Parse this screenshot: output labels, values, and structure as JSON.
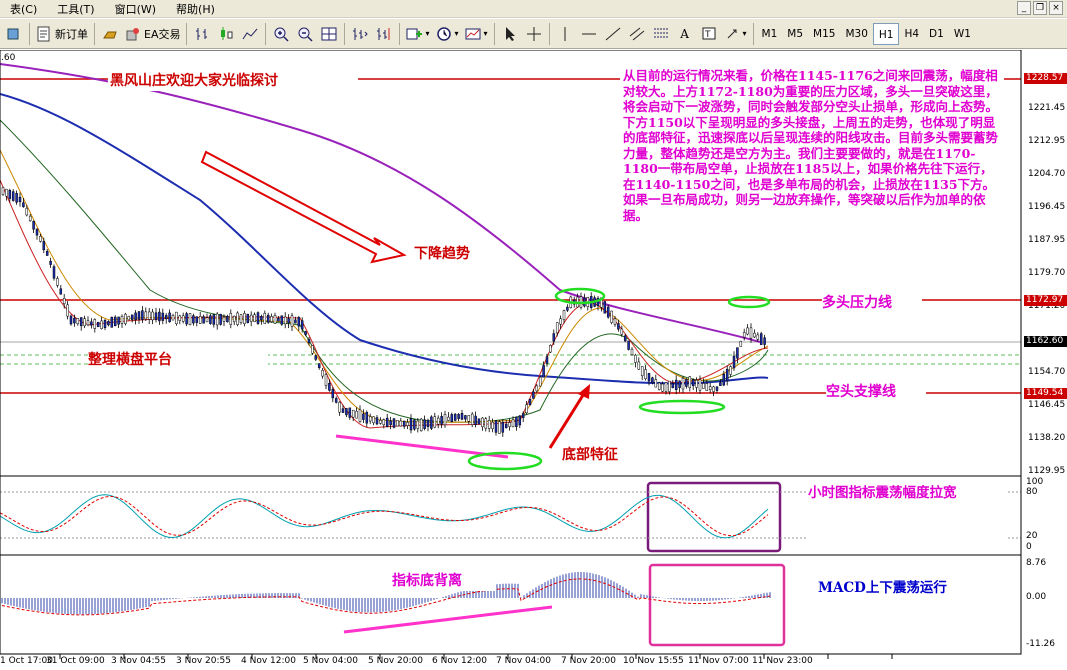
{
  "menu": {
    "items": [
      "表(C)",
      "工具(T)",
      "窗口(W)",
      "帮助(H)"
    ]
  },
  "toolbar": {
    "new_order_label": "新订单",
    "ea_label": "EA交易",
    "timeframes": [
      "M1",
      "M5",
      "M15",
      "M30",
      "H1",
      "H4",
      "D1",
      "W1"
    ],
    "active_timeframe": "H1"
  },
  "annotations": {
    "welcome": "黑风山庄欢迎大家光临探讨",
    "downtrend": "下降趋势",
    "consolidation": "整理横盘平台",
    "bottom_feature": "底部特征",
    "resistance": "多头压力线",
    "support": "空头支撑线",
    "stoch_note": "小时图指标震荡幅度拉宽",
    "divergence": "指标底背离",
    "macd_note": "MACD上下震荡运行",
    "analysis": "从目前的运行情况来看，价格在1145-1176之间来回震荡，幅度相对较大。上方1172-1180为重要的压力区域，多头一旦突破这里，将会启动下一波涨势，同时会触发部分空头止损单，形成向上态势。下方1150以下呈现明显的多头接盘，上周五的走势，也体现了明显的底部特征，迅速探底以后呈现连续的阳线攻击。目前多头需要蓄势力量，整体趋势还是空方为主。我们主要要做的，就是在1170-1180一带布局空单，止损放在1185以上，如果价格先往下运行，在1140-1150之间，也是多单布局的机会，止损放在1135下方。如果一旦布局成功，则另一边放弃操作，等突破以后作为加单的依据。"
  },
  "price_axis": {
    "top_partial": ".60",
    "ticks": [
      "1221.45",
      "1212.95",
      "1204.70",
      "1196.45",
      "1187.95",
      "1179.70",
      "1171.20",
      "1154.70",
      "1146.45",
      "1138.20",
      "1129.95"
    ],
    "tag_resistance": "1228.57",
    "tag_upper": "1172.97",
    "tag_current": "1162.60",
    "tag_support": "1149.54"
  },
  "stoch_axis": {
    "ticks": [
      "100",
      "80",
      "20",
      "0"
    ]
  },
  "macd_axis": {
    "ticks": [
      "8.76",
      "0.00",
      "-11.26"
    ]
  },
  "time_axis": {
    "labels": [
      "1 Oct 17:00",
      "31 Oct 09:00",
      "3 Nov 04:55",
      "3 Nov 20:55",
      "4 Nov 12:00",
      "5 Nov 04:00",
      "5 Nov 20:00",
      "6 Nov 12:00",
      "7 Nov 04:00",
      "7 Nov 20:00",
      "10 Nov 15:55",
      "11 Nov 07:00",
      "11 Nov 23:00"
    ]
  },
  "colors": {
    "resistance_line": "#cc0000",
    "annotation_red": "#cc0000",
    "annotation_magenta": "#e000d0",
    "macd_note": "#0000cc",
    "ma_purple": "#9922bb",
    "ma_blue": "#1c2db0",
    "green_circle": "#22dd22"
  }
}
